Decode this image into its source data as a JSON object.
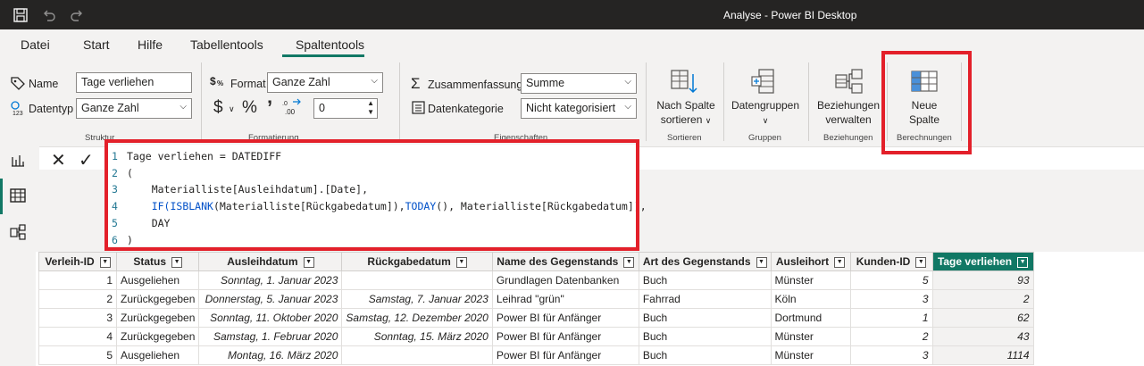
{
  "app_title": "Analyse - Power BI Desktop",
  "tabs": [
    "Datei",
    "Start",
    "Hilfe",
    "Tabellentools",
    "Spaltentools"
  ],
  "struktur": {
    "name_label": "Name",
    "name_value": "Tage verliehen",
    "datentyp_label": "Datentyp",
    "datentyp_value": "Ganze Zahl",
    "group_label": "Struktur"
  },
  "formatierung": {
    "format_label": "Format",
    "format_value": "Ganze Zahl",
    "currency_symbol": "$",
    "percent_symbol": "%",
    "comma_symbol": "’",
    "decimal_value": "0",
    "group_label": "Formatierung"
  },
  "eigenschaften": {
    "zusammenfassung_label": "Zusammenfassung",
    "zusammenfassung_value": "Summe",
    "datenkategorie_label": "Datenkategorie",
    "datenkategorie_value": "Nicht kategorisiert",
    "group_label": "Eigenschaften"
  },
  "sortieren": {
    "btn_line1": "Nach Spalte",
    "btn_line2": "sortieren",
    "group_label": "Sortieren"
  },
  "gruppen": {
    "btn_line1": "Datengruppen",
    "group_label": "Gruppen"
  },
  "beziehungen": {
    "btn_line1": "Beziehungen",
    "btn_line2": "verwalten",
    "group_label": "Beziehungen"
  },
  "berechnungen": {
    "btn_line1": "Neue",
    "btn_line2": "Spalte",
    "group_label": "Berechnungen"
  },
  "formula": {
    "line_numbers": [
      "1",
      "2",
      "3",
      "4",
      "5",
      "6"
    ],
    "l1": "Tage verliehen = DATEDIFF",
    "l2": "(",
    "l3": "    Materialliste[Ausleihdatum].[Date],",
    "l4_kw1": "IF(",
    "l4_kw2": "ISBLANK",
    "l4_a": "(Materialliste[Rückgabedatum]),",
    "l4_kw3": "TODAY",
    "l4_b": "(), Materialliste[Rückgabedatum]),",
    "l5": "    DAY",
    "l6": ")"
  },
  "table": {
    "columns": [
      "Verleih-ID",
      "Status",
      "Ausleihdatum",
      "Rückgabedatum",
      "Name des Gegenstands",
      "Art des Gegenstands",
      "Ausleihort",
      "Kunden-ID",
      "Tage verliehen"
    ],
    "rows": [
      [
        "1",
        "Ausgeliehen",
        "Sonntag, 1. Januar 2023",
        "",
        "Grundlagen Datenbanken",
        "Buch",
        "Münster",
        "5",
        "93"
      ],
      [
        "2",
        "Zurückgegeben",
        "Donnerstag, 5. Januar 2023",
        "Samstag, 7. Januar 2023",
        "Leihrad \"grün\"",
        "Fahrrad",
        "Köln",
        "3",
        "2"
      ],
      [
        "3",
        "Zurückgegeben",
        "Sonntag, 11. Oktober 2020",
        "Samstag, 12. Dezember 2020",
        "Power BI für Anfänger",
        "Buch",
        "Dortmund",
        "1",
        "62"
      ],
      [
        "4",
        "Zurückgegeben",
        "Samstag, 1. Februar 2020",
        "Sonntag, 15. März 2020",
        "Power BI für Anfänger",
        "Buch",
        "Münster",
        "2",
        "43"
      ],
      [
        "5",
        "Ausgeliehen",
        "Montag, 16. März 2020",
        "",
        "Power BI für Anfänger",
        "Buch",
        "Münster",
        "3",
        "1114"
      ]
    ]
  },
  "colors": {
    "accent": "#117865",
    "highlight": "#e3202a"
  }
}
